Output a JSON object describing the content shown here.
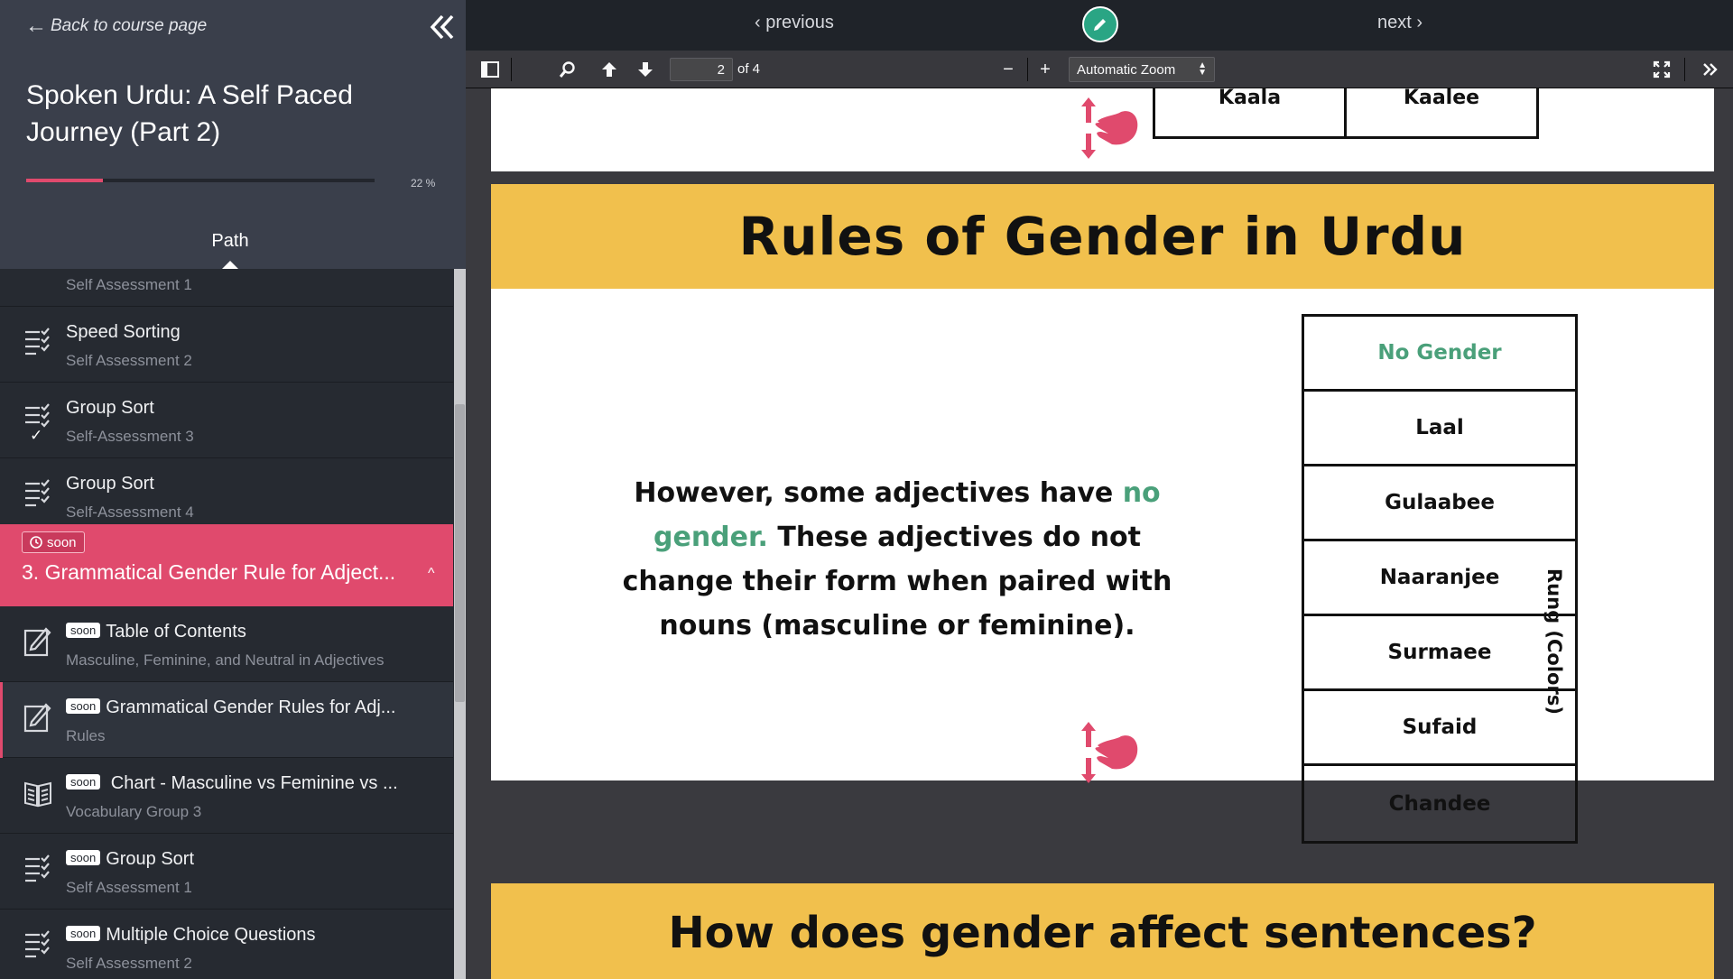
{
  "sidebar": {
    "back_link": "Back to course page",
    "course_title": "Spoken Urdu: A Self Paced Journey (Part 2)",
    "progress": {
      "percent_label": "22 %",
      "value": 0.22
    },
    "path_tab": "Path",
    "partial_item_sub": "Self Assessment 1",
    "items_before": [
      {
        "title": "Speed Sorting",
        "sub": "Self Assessment 2",
        "icon": "checklist-icon",
        "done": false
      },
      {
        "title": "Group Sort",
        "sub": "Self-Assessment 3",
        "icon": "checklist-icon",
        "done": true
      },
      {
        "title": "Group Sort",
        "sub": "Self-Assessment 4",
        "icon": "checklist-icon",
        "done": false
      }
    ],
    "section": {
      "badge": "soon",
      "title": "3. Grammatical Gender Rule for Adject...",
      "chevron": "^"
    },
    "items_after": [
      {
        "soon": "soon",
        "title": "Table of Contents",
        "sub": "Masculine, Feminine, and Neutral in Adjectives",
        "icon": "edit-document-icon",
        "active": false
      },
      {
        "soon": "soon",
        "title": "Grammatical Gender Rules for Adj...",
        "sub": "Rules",
        "icon": "edit-document-icon",
        "active": true
      },
      {
        "soon": "soon",
        "title": " Chart - Masculine vs Feminine vs ...",
        "sub": "Vocabulary Group 3",
        "icon": "book-icon",
        "active": false
      },
      {
        "soon": "soon",
        "title": "Group Sort",
        "sub": "Self Assessment 1",
        "icon": "checklist-icon",
        "active": false
      },
      {
        "soon": "soon",
        "title": "Multiple Choice Questions",
        "sub": "Self Assessment 2",
        "icon": "checklist-icon",
        "active": false
      }
    ],
    "check_mark": "✓"
  },
  "topnav": {
    "previous": "‹ previous",
    "next": "next ›",
    "edit_color": "#2aa584"
  },
  "pdf_toolbar": {
    "page_number": "2",
    "page_count": "of 4",
    "zoom": "Automatic Zoom",
    "zoom_out": "−",
    "zoom_in": "+"
  },
  "document": {
    "top_cells": [
      "Kaala",
      "Kaalee"
    ],
    "banner_title": "Rules of Gender in Urdu",
    "body_text_parts": [
      "However, some adjectives have ",
      "no gender.",
      " These adjectives do not change their form when paired with nouns (masculine or feminine)."
    ],
    "table_header": "No Gender",
    "table_rows": [
      "Laal",
      "Gulaabee",
      "Naaranjee",
      "Surmaee",
      "Sufaid",
      "Chandee"
    ],
    "side_label": "Rung (Colors)",
    "next_banner": "How does gender affect sentences?",
    "accent_color": "#f1c04d",
    "green_color": "#4aa07a",
    "hand_color": "#e04a6d"
  }
}
